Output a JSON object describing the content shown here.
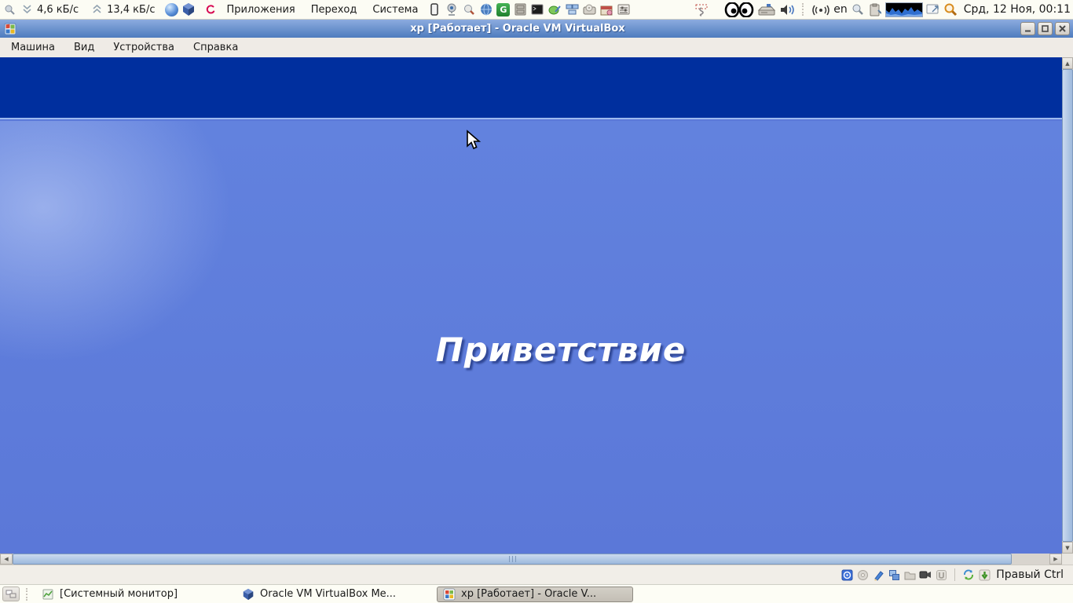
{
  "colors": {
    "xp_band": "#002f9e",
    "xp_background": "#5b79d9",
    "titlebar_top": "#8cabdf",
    "titlebar_bottom": "#4e7cbe",
    "panel_background": "#fcfcf4"
  },
  "top_panel": {
    "net_monitor": {
      "download": "4,6 кБ/с",
      "upload": "13,4 кБ/с"
    },
    "menus": [
      {
        "label": "Приложения"
      },
      {
        "label": "Переход"
      },
      {
        "label": "Система"
      }
    ],
    "launcher_icons": [
      "smartphone",
      "webcam",
      "search-tool",
      "web-browser",
      "green-g-app",
      "file-cabinet",
      "terminal",
      "notes-editor",
      "workspaces",
      "cd-drive",
      "package-box",
      "preferences"
    ],
    "indicator_icons": [
      "tack",
      "eyes",
      "modem",
      "volume",
      "wireless",
      "magnifier",
      "clipboard",
      "network-graph",
      "screenshot",
      "orange-search"
    ],
    "keyboard_layout": "en",
    "clock": "Срд, 12 Ноя, 00:11"
  },
  "vbox_window": {
    "title": "xp [Работает] - Oracle VM VirtualBox",
    "window_buttons": [
      "minimize",
      "maximize",
      "close"
    ],
    "menu_items": [
      {
        "label": "Машина"
      },
      {
        "label": "Вид"
      },
      {
        "label": "Устройства"
      },
      {
        "label": "Справка"
      }
    ],
    "vm_screen": {
      "welcome_text": "Приветствие"
    },
    "status_bar": {
      "device_icons": [
        "hard-disks",
        "optical-drives",
        "display",
        "network",
        "shared-folders",
        "video-capture",
        "usb"
      ],
      "state_icons": [
        "mouse-integration",
        "keyboard-capture"
      ],
      "host_key": "Правый Ctrl"
    }
  },
  "taskbar": {
    "items": [
      {
        "label": "[Системный монитор]",
        "icon": "system-monitor",
        "active": false
      },
      {
        "label": "Oracle VM VirtualBox Me...",
        "icon": "virtualbox",
        "active": false
      },
      {
        "label": "xp [Работает] - Oracle V...",
        "icon": "windows-xp",
        "active": true
      }
    ]
  }
}
